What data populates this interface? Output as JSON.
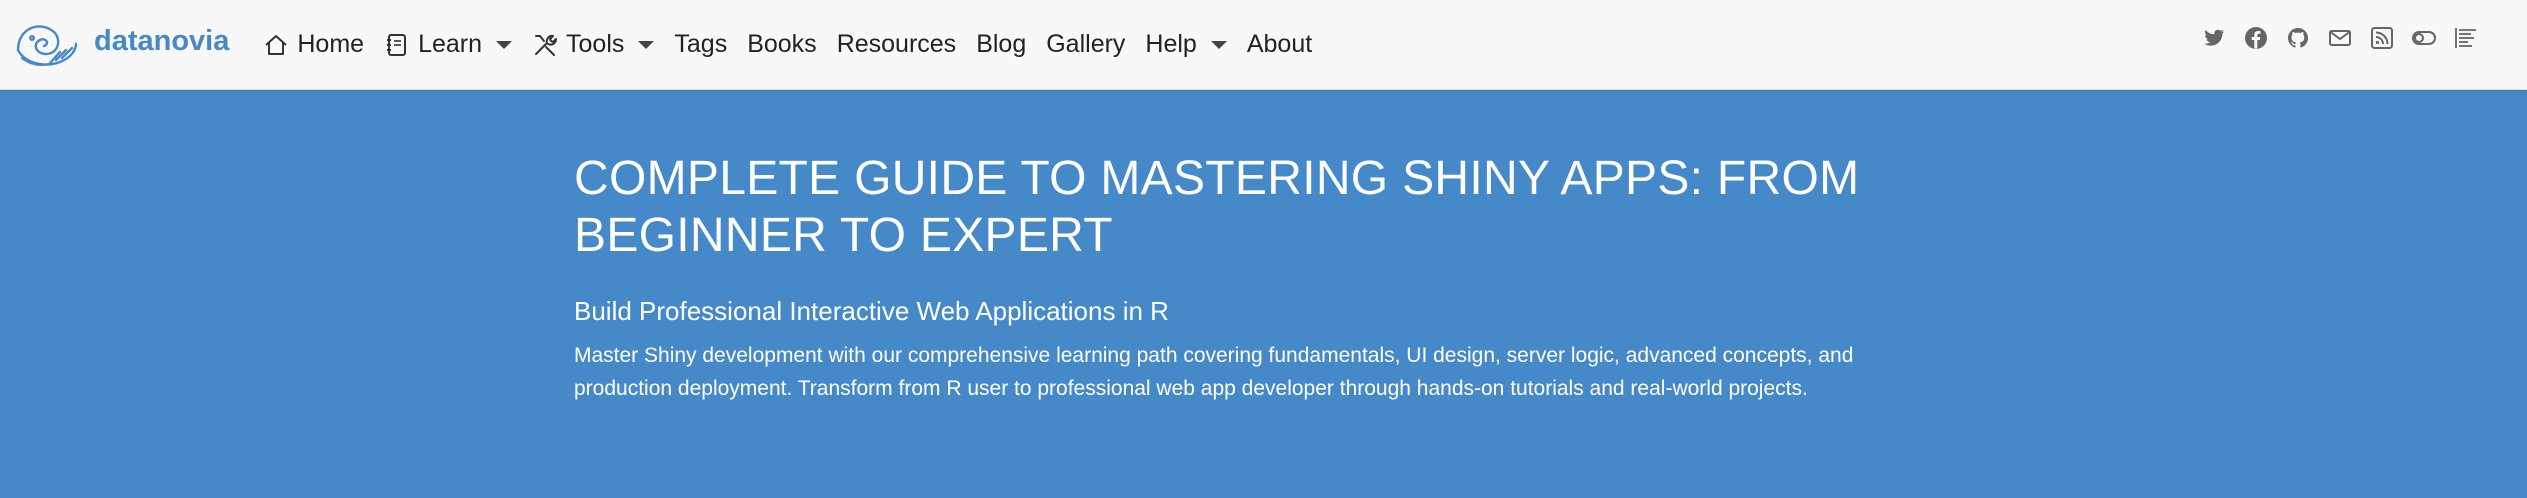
{
  "brand": {
    "name": "datanovia",
    "logo_icon": "nautilus-logo-icon"
  },
  "nav": [
    {
      "label": "Home",
      "icon": "home-icon"
    },
    {
      "label": "Learn",
      "icon": "notebook-icon",
      "dropdown": true
    },
    {
      "label": "Tools",
      "icon": "tools-icon",
      "dropdown": true
    },
    {
      "label": "Tags"
    },
    {
      "label": "Books"
    },
    {
      "label": "Resources"
    },
    {
      "label": "Blog"
    },
    {
      "label": "Gallery"
    },
    {
      "label": "Help",
      "dropdown": true
    },
    {
      "label": "About"
    }
  ],
  "social_icons": [
    "twitter-icon",
    "facebook-icon",
    "github-icon",
    "email-icon",
    "rss-icon",
    "toggle-icon",
    "reader-mode-icon"
  ],
  "hero": {
    "title": "COMPLETE GUIDE TO MASTERING SHINY APPS: FROM BEGINNER TO EXPERT",
    "subtitle": "Build Professional Interactive Web Applications in R",
    "description": "Master Shiny development with our comprehensive learning path covering fundamentals, UI design, server logic, advanced concepts, and production deployment. Transform from R user to professional web app developer through hands-on tutorials and real-world projects."
  },
  "colors": {
    "banner": "#4689c8",
    "brand": "#4689c8",
    "navbar": "#f8f8f8",
    "icon": "#666666"
  }
}
